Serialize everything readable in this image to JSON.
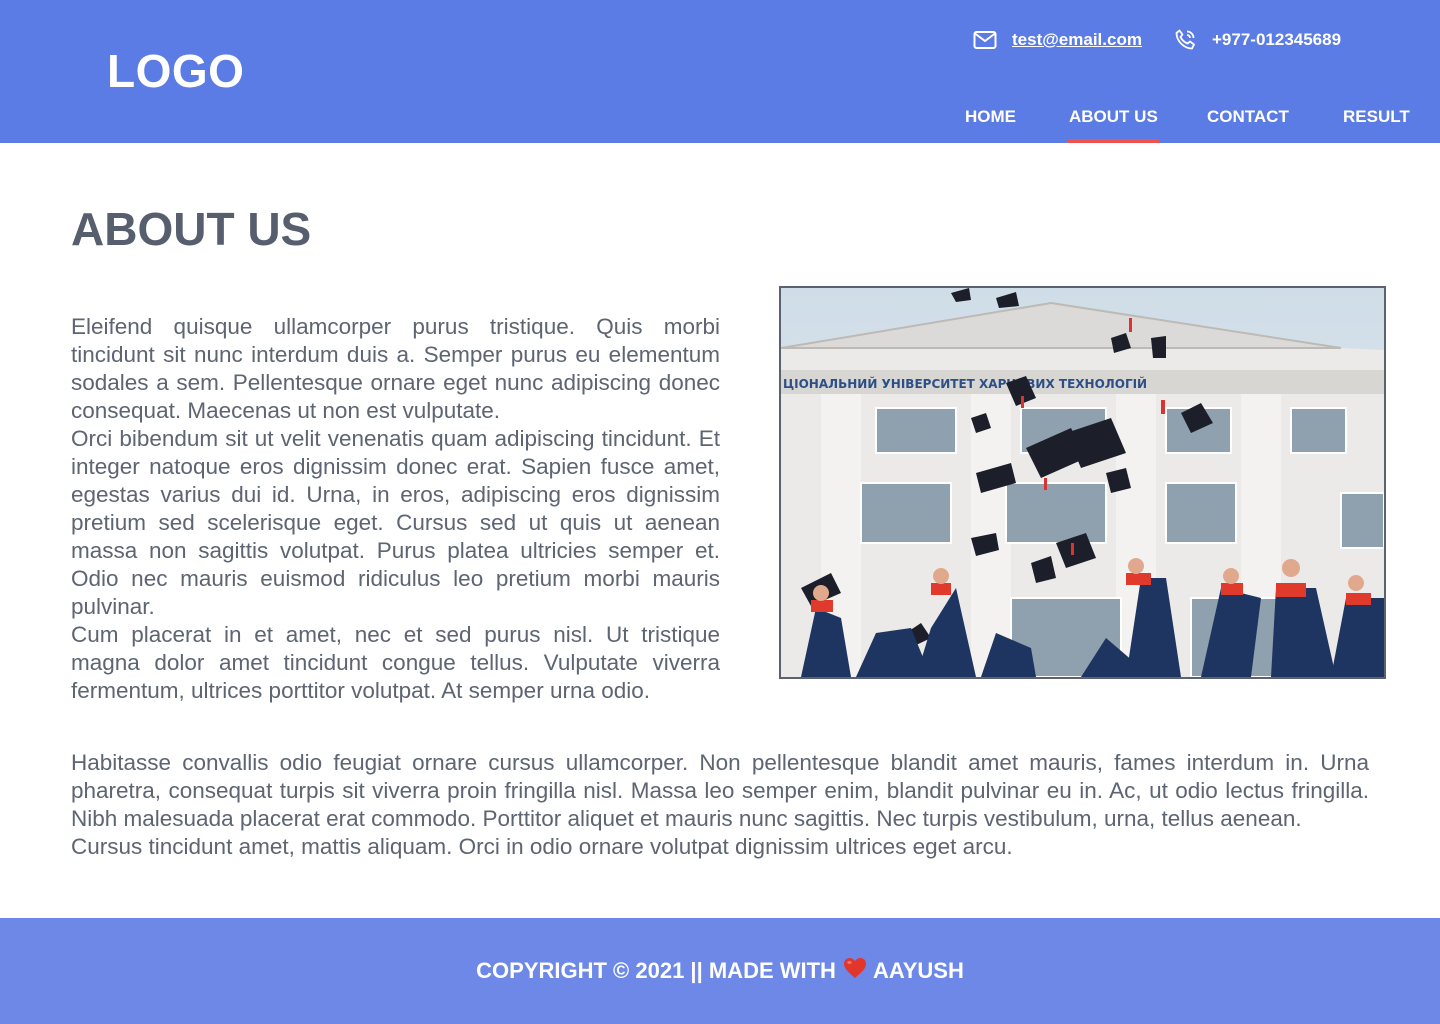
{
  "header": {
    "logo": "LOGO",
    "email": "test@email.com",
    "phone": "+977-012345689",
    "icons": {
      "email": "mail-icon",
      "phone": "phone-icon"
    }
  },
  "nav": {
    "items": [
      {
        "label": "HOME",
        "active": false
      },
      {
        "label": "ABOUT US",
        "active": true
      },
      {
        "label": "CONTACT",
        "active": false
      },
      {
        "label": "RESULT",
        "active": false
      }
    ]
  },
  "main": {
    "title": "ABOUT US",
    "intro": [
      "Eleifend quisque ullamcorper purus tristique. Quis morbi tincidunt sit nunc interdum duis a. Semper purus eu elementum sodales a sem. Pellentesque ornare eget nunc adipiscing donec consequat. Maecenas ut non est vulputate.",
      "Orci bibendum sit ut velit venenatis quam adipiscing tincidunt. Et integer natoque eros dignissim donec erat. Sapien fusce amet, egestas varius dui id. Urna, in eros, adipiscing eros dignissim pretium sed scelerisque eget. Cursus sed ut quis ut aenean massa non sagittis volutpat. Purus platea ultricies semper et. Odio nec mauris euismod ridiculus leo pretium morbi mauris pulvinar.",
      "Cum placerat in et amet, nec et sed purus nisl. Ut tristique magna dolor amet tincidunt congue tellus. Vulputate viverra fermentum, ultrices porttitor volutpat. At semper urna odio."
    ],
    "photo_sign": "ЦІОНАЛЬНИЙ УНІВЕРСИТЕТ ХАРЧОВИХ ТЕХНОЛОГІЙ",
    "outro": [
      "Habitasse convallis odio feugiat ornare cursus ullamcorper. Non pellentesque blandit amet mauris, fames interdum in. Urna pharetra, consequat turpis sit viverra proin fringilla nisl. Massa leo semper enim, blandit pulvinar eu in. Ac, ut odio lectus fringilla. Nibh malesuada placerat erat commodo. Porttitor aliquet et mauris nunc sagittis. Nec turpis vestibulum, urna, tellus aenean.",
      "Cursus tincidunt amet, mattis aliquam. Orci in odio ornare volutpat dignissim ultrices eget arcu."
    ]
  },
  "footer": {
    "text_before": "COPYRIGHT © 2021 || MADE WITH",
    "text_after": "AAYUSH",
    "heart": "heart-icon"
  },
  "colors": {
    "header_bg": "#5b7be5",
    "footer_bg": "#6d88e7",
    "active_underline": "#ef5350",
    "heading_text": "#575e6d",
    "body_text": "#5d6472"
  }
}
